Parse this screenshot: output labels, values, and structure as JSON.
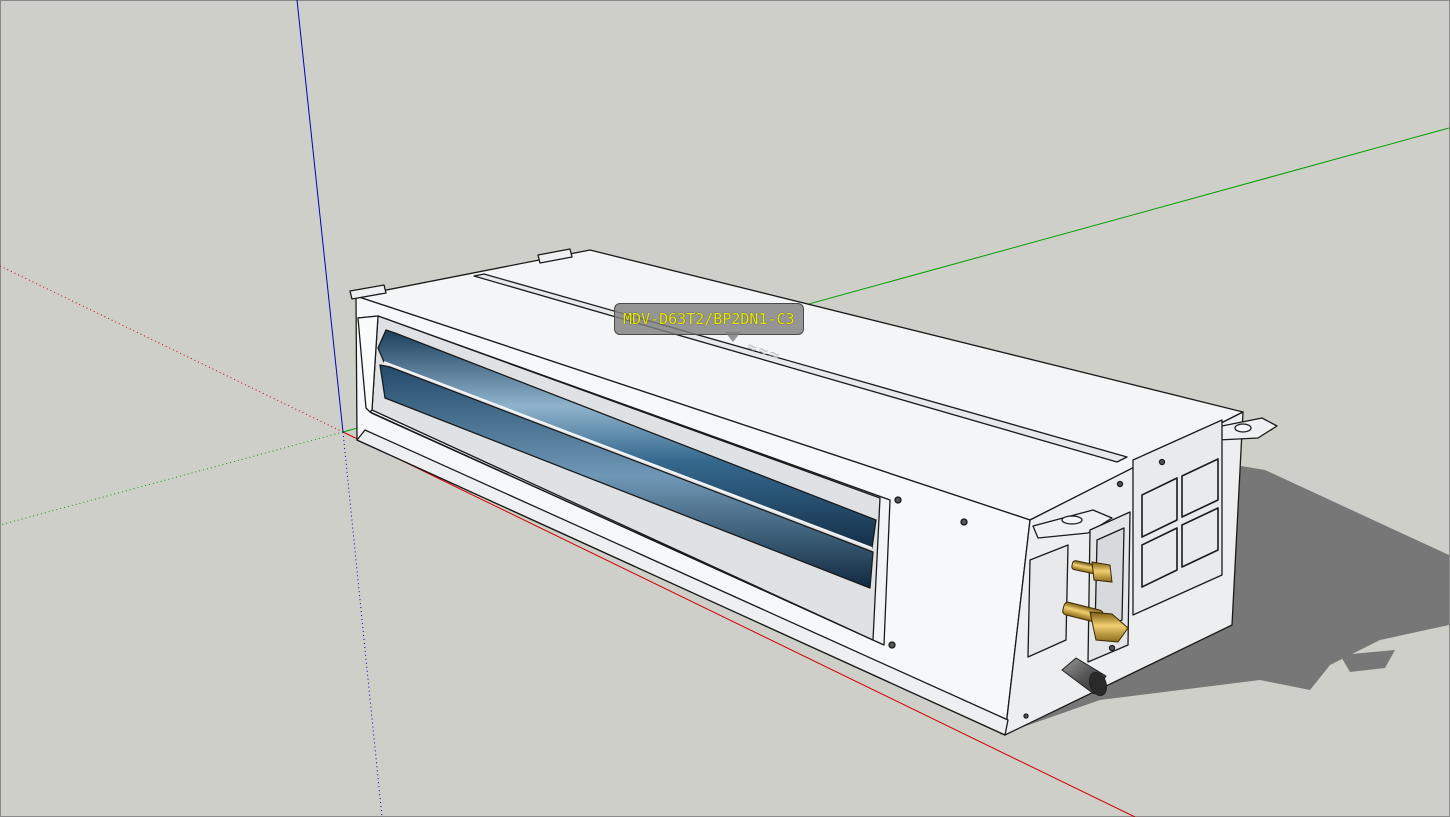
{
  "tooltip": {
    "component_name": "MDV-D63T2/BP2DN1-C3"
  },
  "colors": {
    "background": "#cfcfc9",
    "x_axis": "#d00000",
    "y_axis": "#00a000",
    "z_axis": "#0000c0",
    "shadow": "#777777",
    "body": "#f4f5f6",
    "louver": "#2e5e80",
    "brass": "#c29a2a",
    "tooltip_text": "#e8e800"
  },
  "icons": {
    "axes": "axis-triad-icon",
    "model": "ducted-ac-unit-icon"
  }
}
